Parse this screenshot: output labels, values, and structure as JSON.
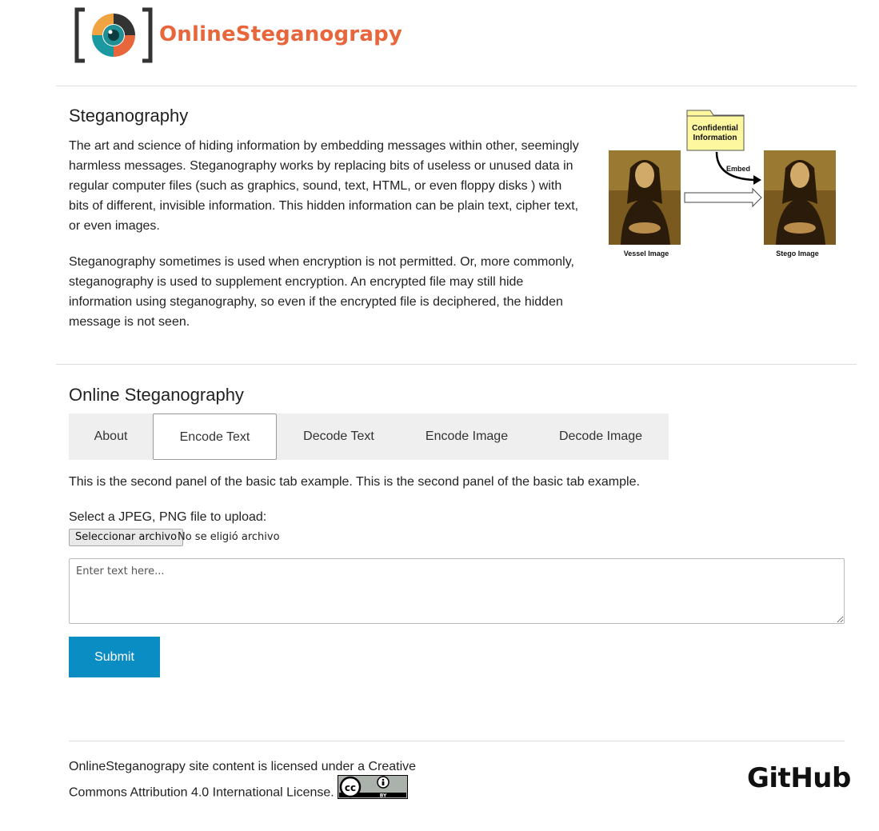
{
  "brand": {
    "name": "OnlineSteganograpy",
    "logo_icon": "camera-lens-logo"
  },
  "intro": {
    "title": "Steganography",
    "paragraph1": "The art and science of hiding information by embedding messages within other, seemingly harmless messages. Steganography works by replacing bits of useless or unused data in regular computer files (such as graphics, sound, text, HTML, or even floppy disks ) with bits of different, invisible information. This hidden information can be plain text, cipher text, or even images.",
    "paragraph2": "Steganography sometimes is used when encryption is not permitted. Or, more commonly, steganography is used to supplement encryption. An encrypted file may still hide information using steganography, so even if the encrypted file is deciphered, the hidden message is not seen.",
    "diagram": {
      "folder_label_line1": "Confidential",
      "folder_label_line2": "Information",
      "arrow_label": "Embed",
      "left_caption": "Vessel Image",
      "right_caption": "Stego Image"
    }
  },
  "tool": {
    "title": "Online Steganography",
    "tabs": [
      {
        "label": "About",
        "active": false
      },
      {
        "label": "Encode Text",
        "active": true
      },
      {
        "label": "Decode Text",
        "active": false
      },
      {
        "label": "Encode Image",
        "active": false
      },
      {
        "label": "Decode Image",
        "active": false
      }
    ],
    "panel_text": "This is the second panel of the basic tab example. This is the second panel of the basic tab example.",
    "upload_label": "Select a JPEG, PNG file to upload:",
    "file_button": "Seleccionar archivo",
    "file_status": "No se eligió archivo",
    "textarea_placeholder": "Enter text here...",
    "submit_label": "Submit"
  },
  "footer": {
    "license_line1": "OnlineSteganograpy site content is licensed under a Creative",
    "license_line2": "Commons Attribution 4.0 International License.",
    "cc_badge_text": "BY",
    "github_label": "GitHub"
  },
  "colors": {
    "brand_orange": "#e8663c",
    "teal": "#1a9aa0",
    "submit_blue": "#0a8dc2"
  }
}
